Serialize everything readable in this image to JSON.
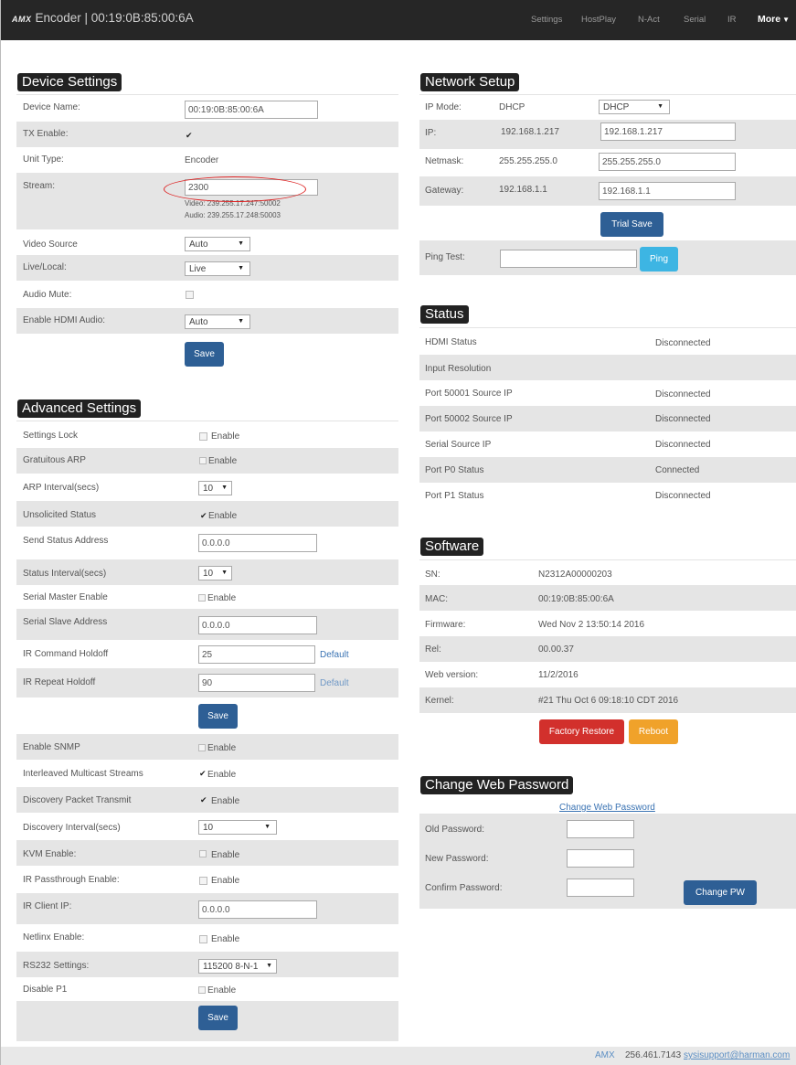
{
  "navbar": {
    "logo": "AMX",
    "title": "Encoder | 00:19:0B:85:00:6A",
    "items": [
      "Settings",
      "HostPlay",
      "N-Act",
      "Serial",
      "IR"
    ],
    "more": "More"
  },
  "device_settings": {
    "title": "Device Settings",
    "device_name_label": "Device Name:",
    "device_name_value": "00:19:0B:85:00:6A",
    "tx_enable_label": "TX Enable:",
    "tx_enable_checked": true,
    "unit_type_label": "Unit Type:",
    "unit_type_value": "Encoder",
    "stream_label": "Stream:",
    "stream_value": "2300",
    "stream_video": "Video: 239.255.17.247:50002",
    "stream_audio": "Audio: 239.255.17.248:50003",
    "video_source_label": "Video Source",
    "video_source_value": "Auto",
    "live_local_label": "Live/Local:",
    "live_local_value": "Live",
    "audio_mute_label": "Audio Mute:",
    "audio_mute_checked": false,
    "hdmi_audio_label": "Enable HDMI Audio:",
    "hdmi_audio_value": "Auto",
    "save_label": "Save"
  },
  "advanced_settings": {
    "title": "Advanced Settings",
    "enable_label": "Enable",
    "default_label": "Default",
    "settings_lock_label": "Settings Lock",
    "gratuitous_arp_label": "Gratuitous ARP",
    "arp_interval_label": "ARP Interval(secs)",
    "arp_interval_value": "10",
    "unsolicited_status_label": "Unsolicited Status",
    "unsolicited_status_checked": true,
    "send_status_address_label": "Send Status Address",
    "send_status_address_value": "0.0.0.0",
    "status_interval_label": "Status Interval(secs)",
    "status_interval_value": "10",
    "serial_master_label": "Serial Master Enable",
    "serial_slave_address_label": "Serial Slave Address",
    "serial_slave_address_value": "0.0.0.0",
    "ir_command_holdoff_label": "IR Command Holdoff",
    "ir_command_holdoff_value": "25",
    "ir_repeat_holdoff_label": "IR Repeat Holdoff",
    "ir_repeat_holdoff_value": "90",
    "save_label": "Save",
    "enable_snmp_label": "Enable SNMP",
    "interleaved_label": "Interleaved Multicast Streams",
    "interleaved_checked": true,
    "discovery_packet_label": "Discovery Packet Transmit",
    "discovery_packet_checked": true,
    "discovery_interval_label": "Discovery Interval(secs)",
    "discovery_interval_value": "10",
    "kvm_enable_label": "KVM Enable:",
    "ir_passthrough_label": "IR Passthrough Enable:",
    "ir_client_ip_label": "IR Client IP:",
    "ir_client_ip_value": "0.0.0.0",
    "netlinx_label": "Netlinx Enable:",
    "rs232_label": "RS232 Settings:",
    "rs232_value": "115200 8-N-1",
    "disable_p1_label": "Disable P1",
    "save2_label": "Save"
  },
  "network": {
    "title": "Network Setup",
    "ip_mode_label": "IP Mode:",
    "ip_mode_value": "DHCP",
    "ip_mode_select": "DHCP",
    "ip_label": "IP:",
    "ip_value": "192.168.1.217",
    "ip_input": "192.168.1.217",
    "netmask_label": "Netmask:",
    "netmask_value": "255.255.255.0",
    "netmask_input": "255.255.255.0",
    "gateway_label": "Gateway:",
    "gateway_value": "192.168.1.1",
    "gateway_input": "192.168.1.1",
    "trial_save_label": "Trial Save",
    "ping_label": "Ping Test:",
    "ping_value": "",
    "ping_button": "Ping"
  },
  "status": {
    "title": "Status",
    "rows": [
      {
        "label": "HDMI Status",
        "value": "Disconnected"
      },
      {
        "label": "Input Resolution",
        "value": ""
      },
      {
        "label": "Port 50001 Source IP",
        "value": "Disconnected"
      },
      {
        "label": "Port 50002 Source IP",
        "value": "Disconnected"
      },
      {
        "label": "Serial Source IP",
        "value": "Disconnected"
      },
      {
        "label": "Port P0 Status",
        "value": "Connected"
      },
      {
        "label": "Port P1 Status",
        "value": "Disconnected"
      }
    ]
  },
  "software": {
    "title": "Software",
    "rows": [
      {
        "label": "SN:",
        "value": "N2312A00000203"
      },
      {
        "label": "MAC:",
        "value": "00:19:0B:85:00:6A"
      },
      {
        "label": "Firmware:",
        "value": "Wed Nov 2 13:50:14 2016"
      },
      {
        "label": "Rel:",
        "value": "00.00.37"
      },
      {
        "label": "Web version:",
        "value": "11/2/2016"
      },
      {
        "label": "Kernel:",
        "value": "#21 Thu Oct 6 09:18:10 CDT 2016"
      }
    ],
    "factory_restore_label": "Factory Restore",
    "reboot_label": "Reboot"
  },
  "password": {
    "title": "Change Web Password",
    "link_label": "Change Web Password",
    "old_label": "Old Password:",
    "new_label": "New Password:",
    "confirm_label": "Confirm Password:",
    "button_label": "Change PW"
  },
  "footer": {
    "brand": "AMX",
    "phone": "256.461.7143",
    "email": "sysisupport@harman.com"
  },
  "colors": {
    "navbar": "#262626",
    "primary_button": "#2e5f95",
    "ping_button": "#3db5e3",
    "danger_button": "#d2302c",
    "warning_button": "#f0a22a",
    "link": "#3a73b3",
    "annotation": "#dd2222"
  }
}
